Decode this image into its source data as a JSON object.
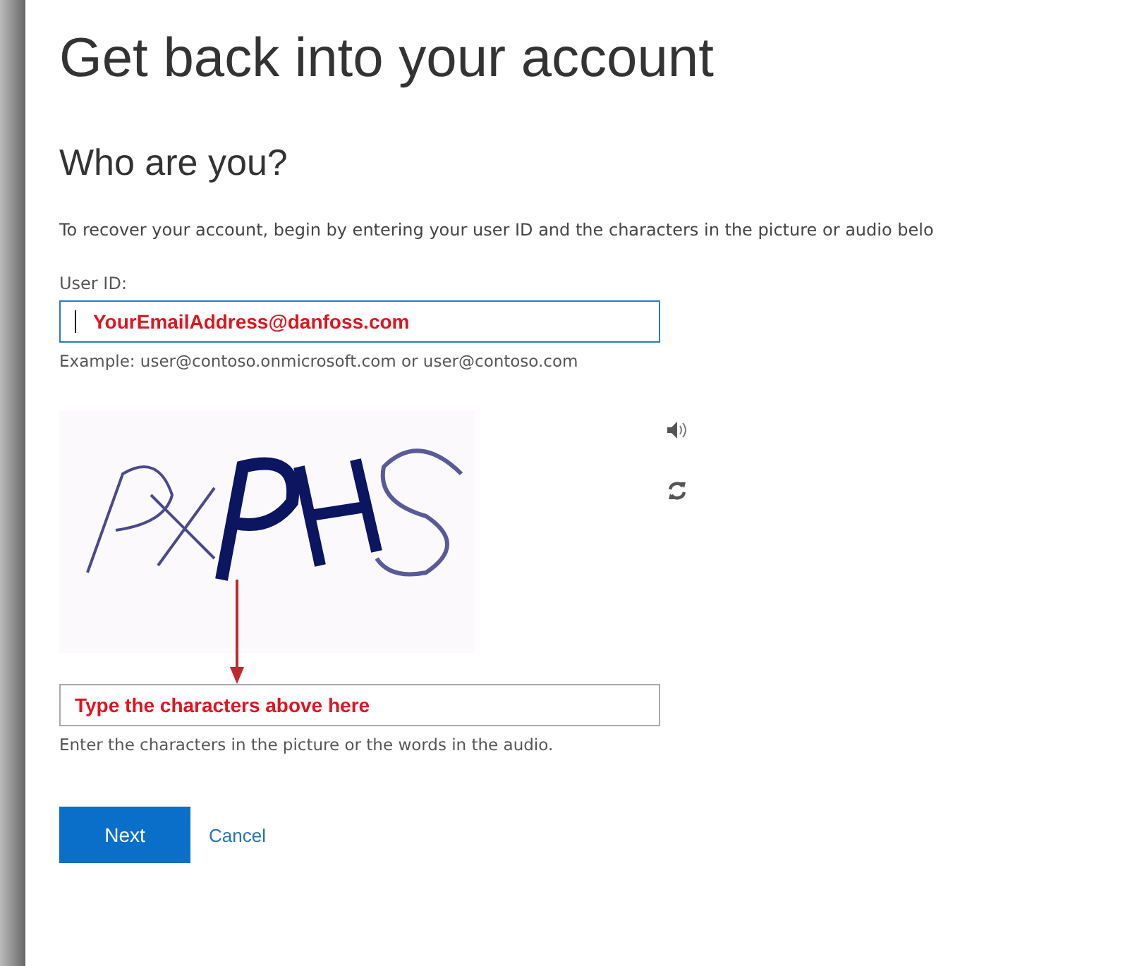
{
  "title": "Get back into your account",
  "subtitle": "Who are you?",
  "intro": "To recover your account, begin by entering your user ID and the characters in the picture or audio belo",
  "user_id": {
    "label": "User ID:",
    "value": "YourEmailAddress@danfoss.com",
    "hint": "Example: user@contoso.onmicrosoft.com or user@contoso.com"
  },
  "captcha": {
    "kind": "picture",
    "answer": "Type the characters above here",
    "hint": "Enter the characters in the picture or the words in the audio."
  },
  "buttons": [
    {
      "label": "Next",
      "kind": "primary"
    },
    {
      "label": "Cancel",
      "kind": "link"
    }
  ]
}
